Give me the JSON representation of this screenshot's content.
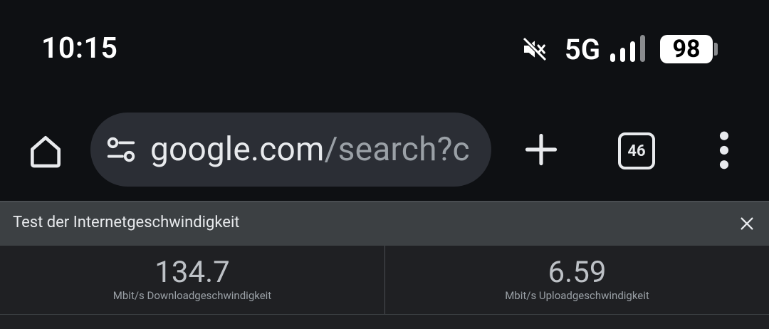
{
  "status_bar": {
    "time": "10:15",
    "network_type": "5G",
    "battery_level": "98",
    "icons": [
      "mute-icon",
      "signal-icon",
      "battery-icon"
    ]
  },
  "toolbar": {
    "url_host": "google.com",
    "url_path": "/search?c",
    "tab_count": "46",
    "icons": [
      "home-icon",
      "tune-icon",
      "plus-icon",
      "tabs-icon",
      "more-vert-icon"
    ]
  },
  "speed_test": {
    "title": "Test der Internetgeschwindigkeit",
    "download": {
      "value": "134.7",
      "label": "Mbit/s Downloadgeschwindigkeit"
    },
    "upload": {
      "value": "6.59",
      "label": "Mbit/s Uploadgeschwindigkeit"
    }
  },
  "colors": {
    "background": "#0e1013",
    "omnibox": "#2b2e35",
    "header": "#3c4043",
    "panel": "#1f2023"
  }
}
